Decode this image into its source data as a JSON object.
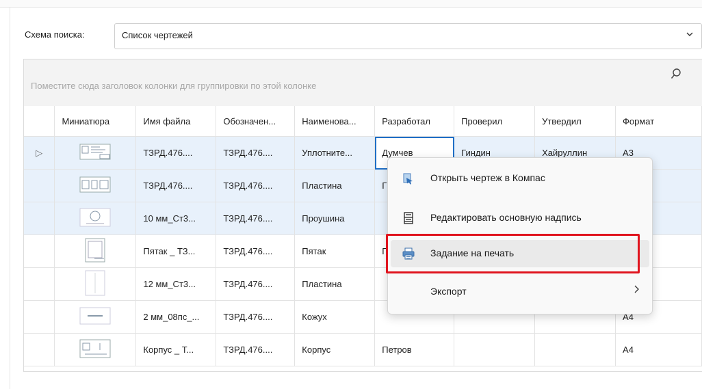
{
  "scheme": {
    "label": "Схема поиска:",
    "value": "Список чертежей"
  },
  "grid": {
    "group_hint": "Поместите сюда заголовок колонки для группировки по этой колонке",
    "columns": [
      "Миниатюра",
      "Имя файла",
      "Обозначен...",
      "Наименова...",
      "Разработал",
      "Проверил",
      "Утвердил",
      "Формат"
    ],
    "rows": [
      {
        "indicator": "▷",
        "file": "ТЗРД.476....",
        "designation": "ТЗРД.476....",
        "name": "Уплотните...",
        "developer": "Думчев",
        "checker": "Гиндин",
        "approver": "Хайруллин",
        "format": "А3"
      },
      {
        "indicator": "",
        "file": "ТЗРД.476....",
        "designation": "ТЗРД.476....",
        "name": "Пластина",
        "developer": "Г",
        "checker": "",
        "approver": "",
        "format": ""
      },
      {
        "indicator": "",
        "file": "10 мм_Ст3...",
        "designation": "ТЗРД.476....",
        "name": "Проушина",
        "developer": "",
        "checker": "",
        "approver": "",
        "format": ""
      },
      {
        "indicator": "",
        "file": "Пятак _ ТЗ...",
        "designation": "ТЗРД.476....",
        "name": "Пятак",
        "developer": "П",
        "checker": "",
        "approver": "",
        "format": ""
      },
      {
        "indicator": "",
        "file": "12 мм_Ст3...",
        "designation": "ТЗРД.476....",
        "name": "Пластина",
        "developer": "",
        "checker": "",
        "approver": "",
        "format": ""
      },
      {
        "indicator": "",
        "file": "2 мм_08пс_...",
        "designation": "ТЗРД.476....",
        "name": "Кожух",
        "developer": "",
        "checker": "",
        "approver": "",
        "format": "А4"
      },
      {
        "indicator": "",
        "file": "Корпус _ Т...",
        "designation": "ТЗРД.476....",
        "name": "Корпус",
        "developer": "Петров",
        "checker": "",
        "approver": "",
        "format": "А4"
      }
    ]
  },
  "context_menu": {
    "open_in_kompas": "Открыть чертеж в Компас",
    "edit_title_block": "Редактировать основную надпись",
    "print_task": "Задание на печать",
    "export": "Экспорт"
  },
  "colors": {
    "highlight_box": "#e0141e",
    "selected_row": "#e8f1fb",
    "active_cell": "#1f6fc6"
  }
}
